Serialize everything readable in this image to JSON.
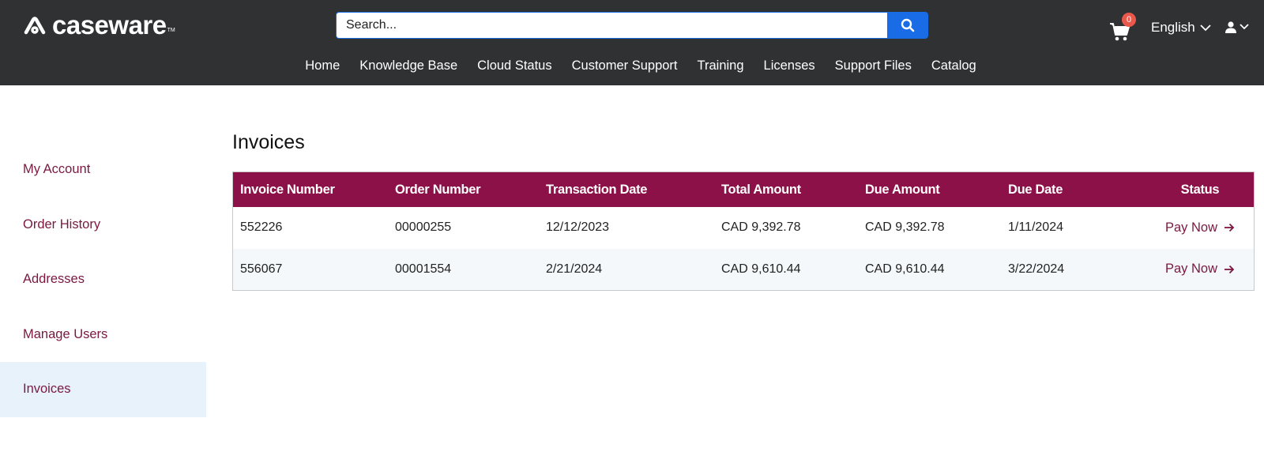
{
  "brand": {
    "name": "caseware",
    "trademark": "TM"
  },
  "search": {
    "placeholder": "Search...",
    "button_icon": "search-icon"
  },
  "cart": {
    "count": "0",
    "icon": "cart-icon"
  },
  "language": {
    "label": "English"
  },
  "user": {
    "icon": "user-icon"
  },
  "nav": [
    {
      "label": "Home"
    },
    {
      "label": "Knowledge Base"
    },
    {
      "label": "Cloud Status"
    },
    {
      "label": "Customer Support"
    },
    {
      "label": "Training"
    },
    {
      "label": "Licenses"
    },
    {
      "label": "Support Files"
    },
    {
      "label": "Catalog"
    }
  ],
  "sidebar": [
    {
      "label": "My Account",
      "active": false
    },
    {
      "label": "Order History",
      "active": false
    },
    {
      "label": "Addresses",
      "active": false
    },
    {
      "label": "Manage Users",
      "active": false
    },
    {
      "label": "Invoices",
      "active": true
    }
  ],
  "page": {
    "title": "Invoices"
  },
  "invoices": {
    "columns": [
      "Invoice Number",
      "Order Number",
      "Transaction Date",
      "Total Amount",
      "Due Amount",
      "Due Date",
      "Status"
    ],
    "rows": [
      {
        "invoice_number": "552226",
        "order_number": "00000255",
        "transaction_date": "12/12/2023",
        "total_amount": "CAD 9,392.78",
        "due_amount": "CAD 9,392.78",
        "due_date": "1/11/2024",
        "status": "Pay Now"
      },
      {
        "invoice_number": "556067",
        "order_number": "00001554",
        "transaction_date": "2/21/2024",
        "total_amount": "CAD 9,610.44",
        "due_amount": "CAD 9,610.44",
        "due_date": "3/22/2024",
        "status": "Pay Now"
      }
    ]
  },
  "colors": {
    "header_bg": "#2f3132",
    "accent": "#8b1148",
    "link": "#7a1840",
    "search_blue": "#1a6be6",
    "badge": "#e9584a",
    "active_bg": "#e8f2fb"
  }
}
